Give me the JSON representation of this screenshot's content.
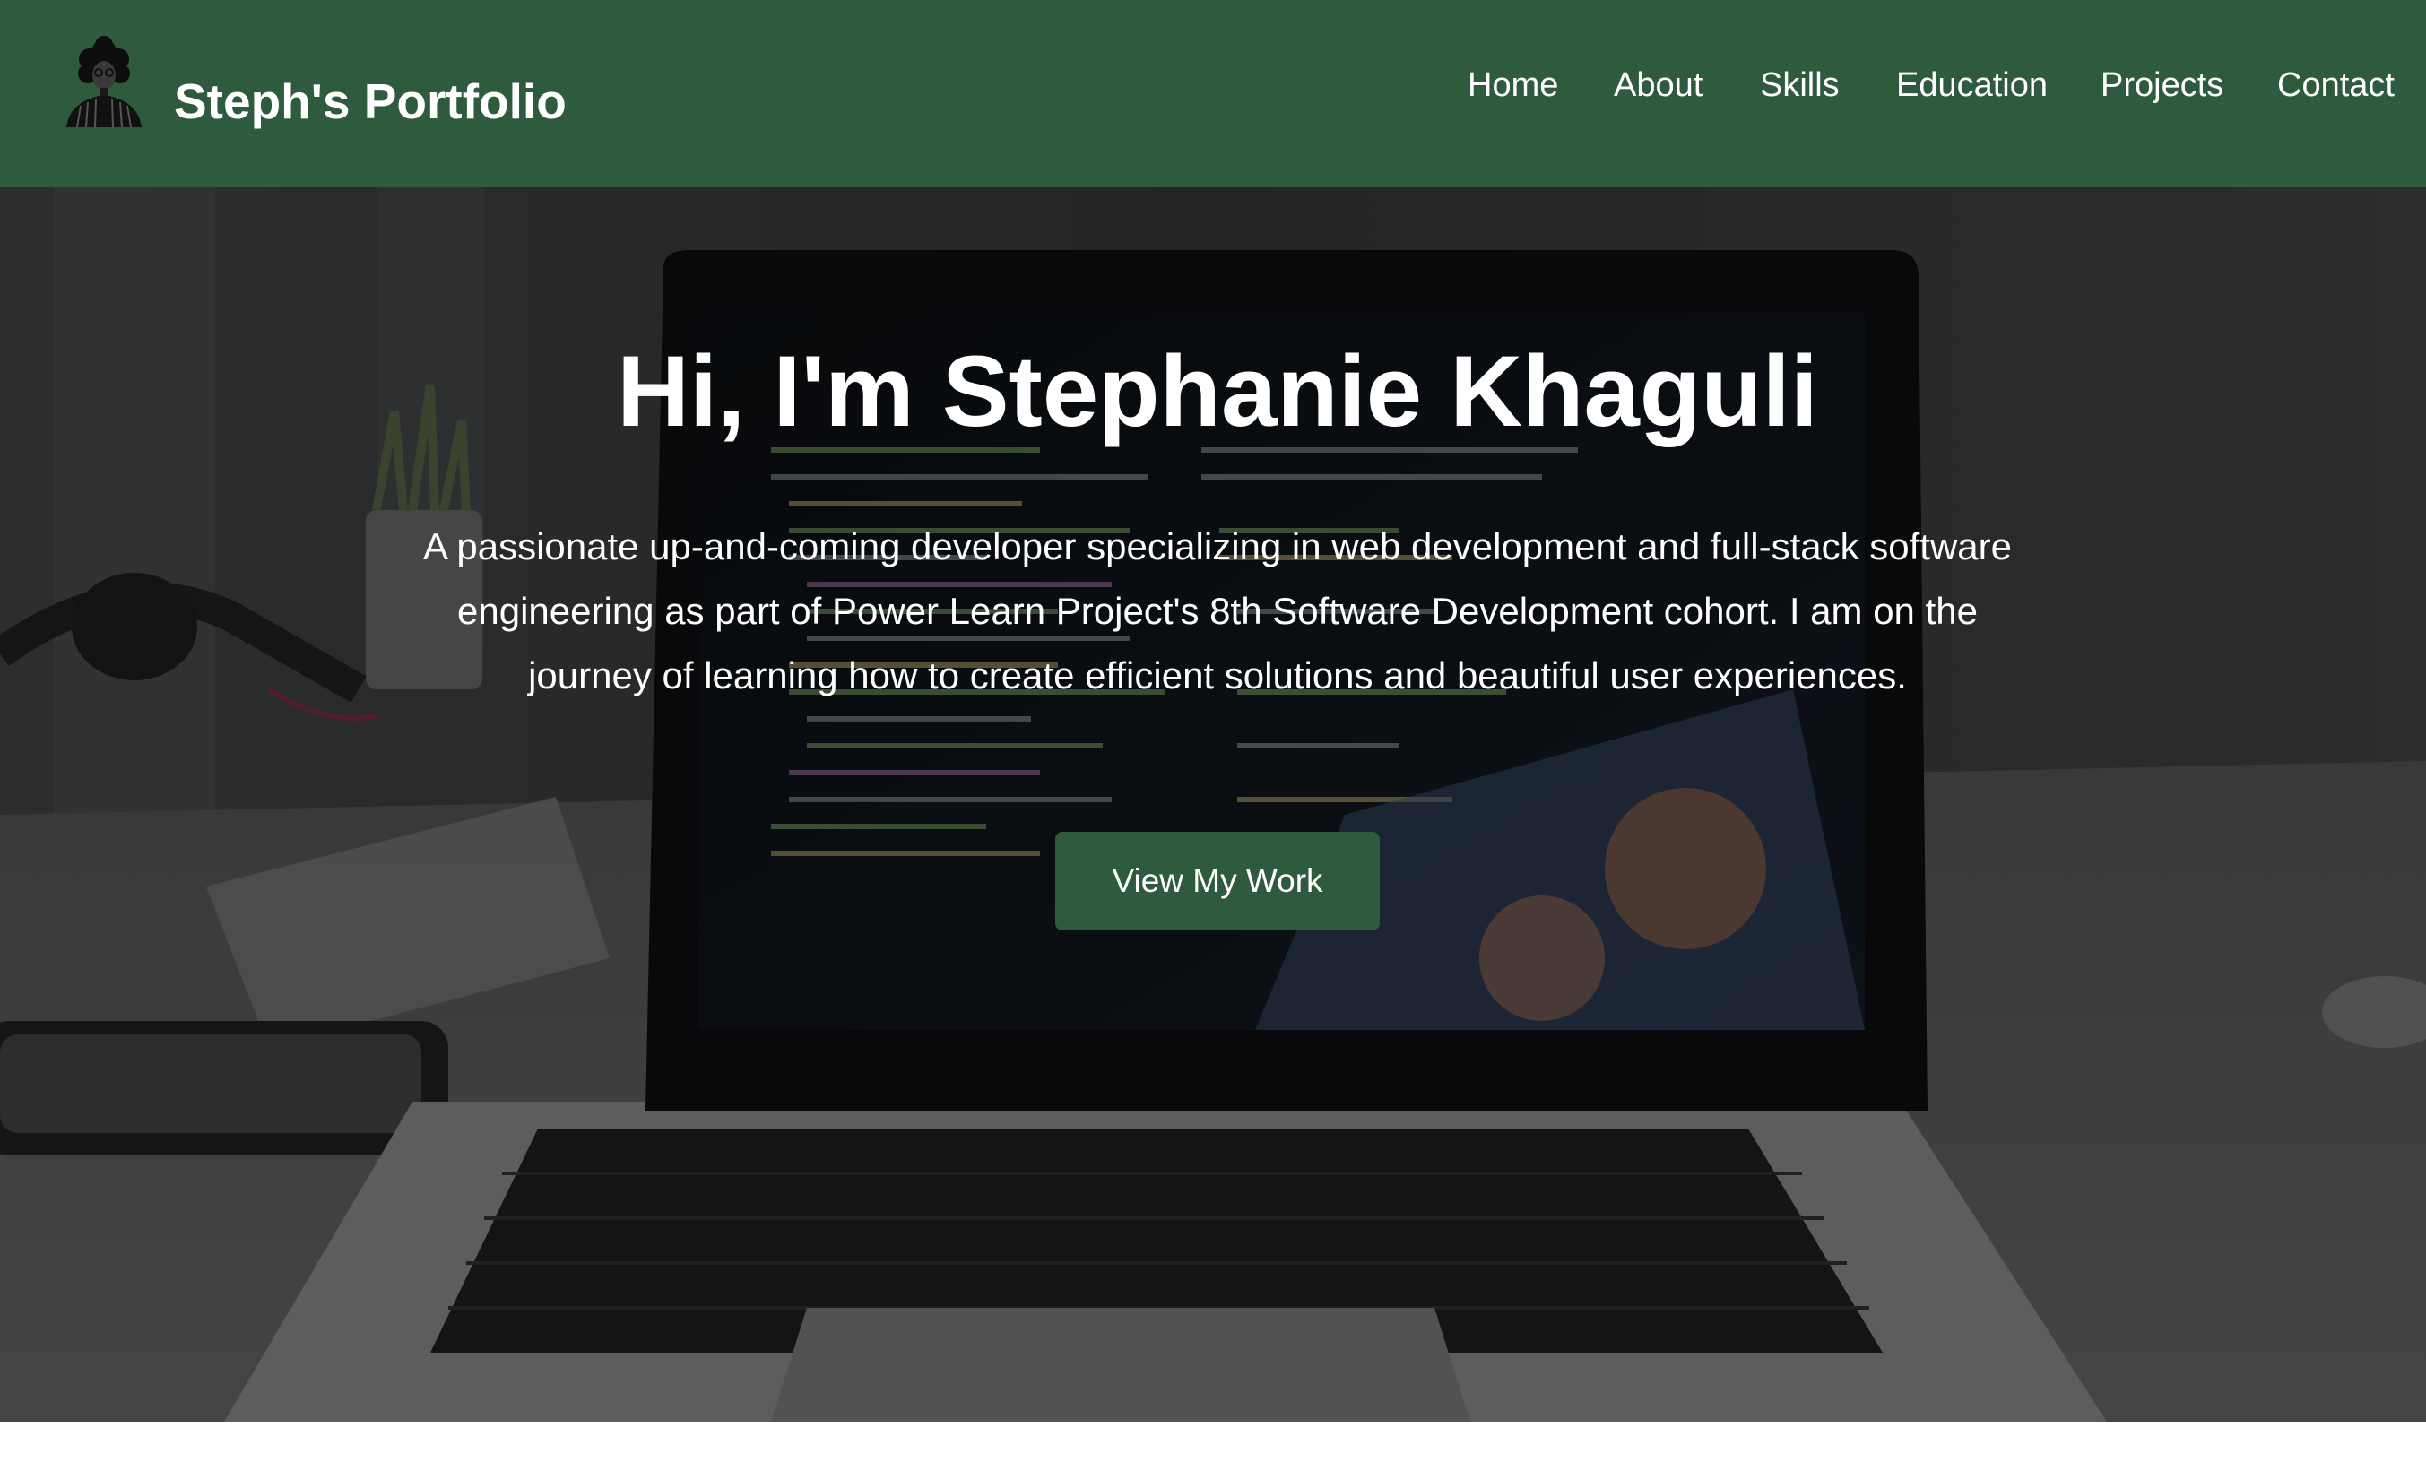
{
  "header": {
    "brand": "Steph's Portfolio",
    "logo_icon": "portrait-silhouette-icon",
    "nav": [
      {
        "label": "Home"
      },
      {
        "label": "About"
      },
      {
        "label": "Skills"
      },
      {
        "label": "Education"
      },
      {
        "label": "Projects"
      },
      {
        "label": "Contact"
      }
    ]
  },
  "hero": {
    "title": "Hi, I'm Stephanie Khaguli",
    "description": "A passionate up-and-coming developer specializing in web development and full-stack software engineering as part of Power Learn Project's 8th Software Development cohort. I am on the journey of learning how to create efficient solutions and beautiful user experiences.",
    "cta_label": "View My Work",
    "background_icon": "laptop-code-photo"
  },
  "colors": {
    "primary": "#2e5a3e",
    "text": "#ffffff"
  }
}
